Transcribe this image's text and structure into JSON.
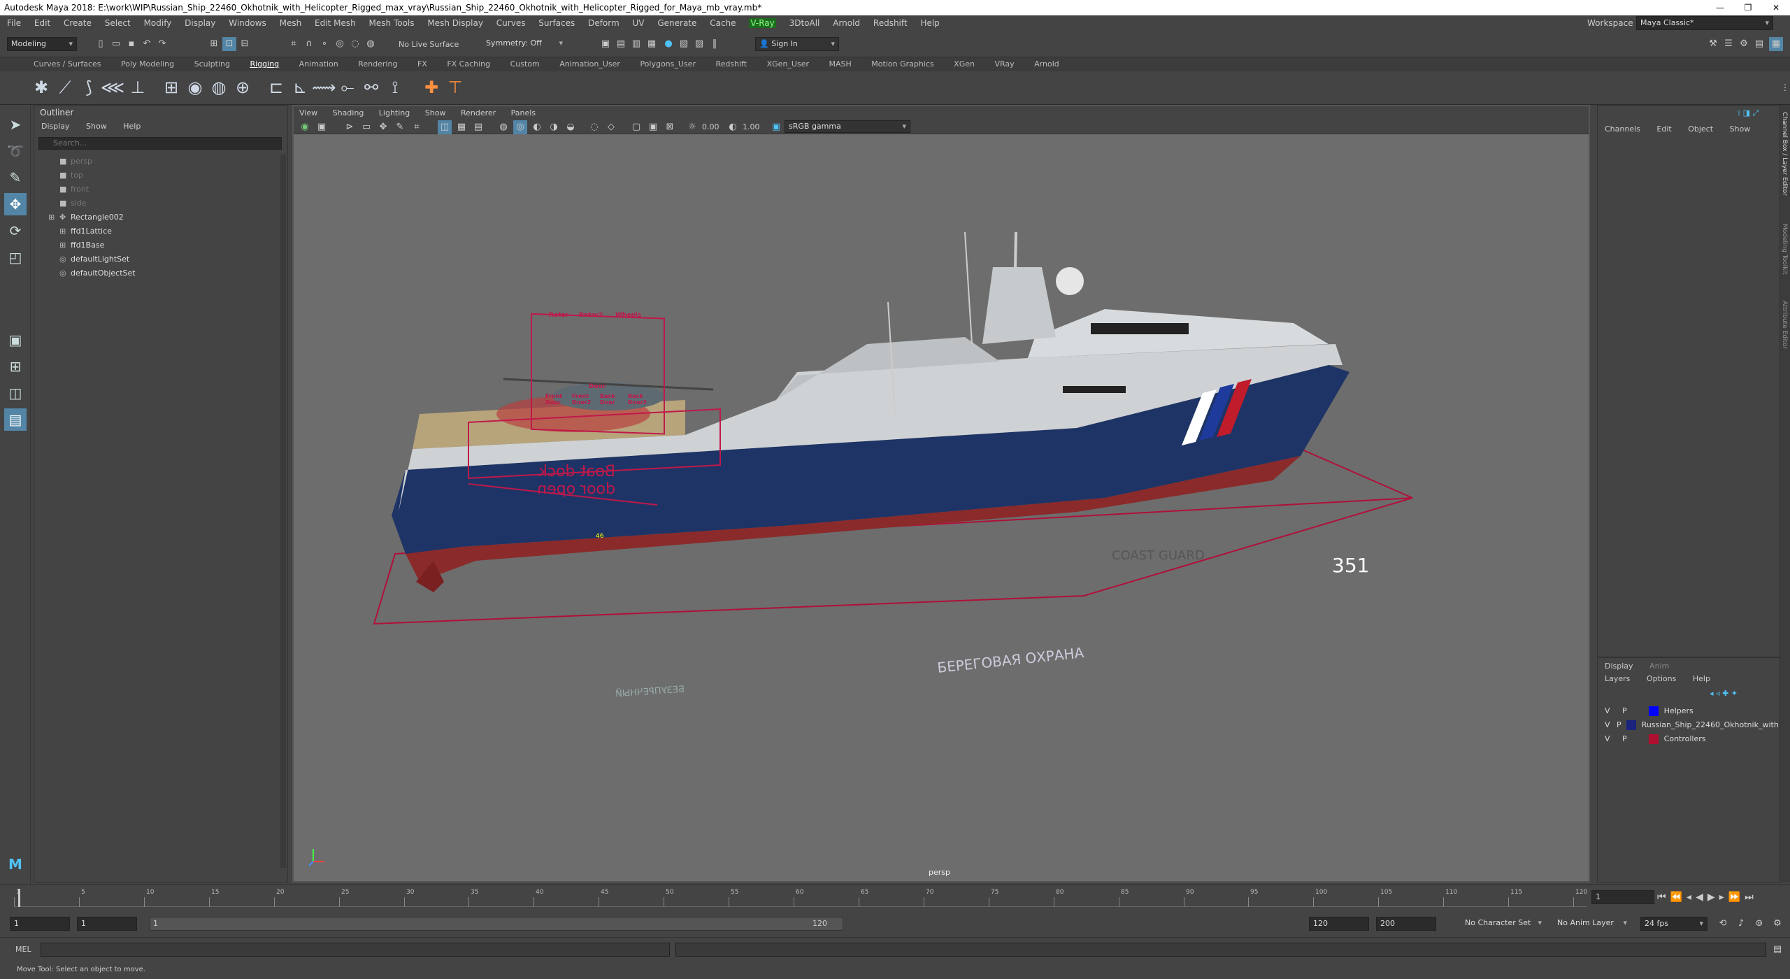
{
  "window": {
    "title": "Autodesk Maya 2018: E:\\work\\WIP\\Russian_Ship_22460_Okhotnik_with_Helicopter_Rigged_max_vray\\Russian_Ship_22460_Okhotnik_with_Helicopter_Rigged_for_Maya_mb_vray.mb*"
  },
  "menubar": [
    "File",
    "Edit",
    "Create",
    "Select",
    "Modify",
    "Display",
    "Windows",
    "Mesh",
    "Edit Mesh",
    "Mesh Tools",
    "Mesh Display",
    "Curves",
    "Surfaces",
    "Deform",
    "UV",
    "Generate",
    "Cache",
    "V-Ray",
    "3DtoAll",
    "Arnold",
    "Redshift",
    "Help"
  ],
  "workspace": {
    "label": "Workspace :",
    "value": "Maya Classic*"
  },
  "statusline": {
    "mode": "Modeling",
    "live_surface": "No Live Surface",
    "symmetry": "Symmetry: Off",
    "sign_in": "Sign In"
  },
  "shelf_tabs": [
    "Curves / Surfaces",
    "Poly Modeling",
    "Sculpting",
    "Rigging",
    "Animation",
    "Rendering",
    "FX",
    "FX Caching",
    "Custom",
    "Animation_User",
    "Polygons_User",
    "Redshift",
    "XGen_User",
    "MASH",
    "Motion Graphics",
    "XGen",
    "VRay",
    "Arnold"
  ],
  "shelf_active": "Rigging",
  "outliner": {
    "title": "Outliner",
    "menu": [
      "Display",
      "Show",
      "Help"
    ],
    "search_placeholder": "Search...",
    "items": [
      {
        "label": "persp",
        "icon": "camera-icon",
        "dim": true
      },
      {
        "label": "top",
        "icon": "camera-icon",
        "dim": true
      },
      {
        "label": "front",
        "icon": "camera-icon",
        "dim": true
      },
      {
        "label": "side",
        "icon": "camera-icon",
        "dim": true
      },
      {
        "label": "Rectangle002",
        "icon": "transform-icon",
        "dim": false
      },
      {
        "label": "ffd1Lattice",
        "icon": "lattice-icon",
        "dim": false
      },
      {
        "label": "ffd1Base",
        "icon": "lattice-icon",
        "dim": false
      },
      {
        "label": "defaultLightSet",
        "icon": "set-icon",
        "dim": false
      },
      {
        "label": "defaultObjectSet",
        "icon": "set-icon",
        "dim": false
      }
    ]
  },
  "viewport": {
    "menu": [
      "View",
      "Shading",
      "Lighting",
      "Show",
      "Renderer",
      "Panels"
    ],
    "exposure": "0.00",
    "gamma": "1.00",
    "color_space": "sRGB gamma",
    "camera": "persp",
    "scene_text": {
      "controls_top": [
        "Rotor",
        "Rotor2",
        "Wheels"
      ],
      "door_header": "Door",
      "controls_bottom": [
        "Front Door",
        "Front Door2",
        "Back Door",
        "Back Door2"
      ],
      "dock_label": "Boat dock door open",
      "hull_number": "351",
      "coast_guard": "COAST GUARD",
      "russian_text": "БЕРЕГОВАЯ ОХРАНА",
      "ship_name": "БЕЗУПРЕЧНЫЙ",
      "heli_number": "46"
    }
  },
  "channelbox": {
    "menu": [
      "Channels",
      "Edit",
      "Object",
      "Show"
    ]
  },
  "layer_editor": {
    "tabs": [
      "Display",
      "Anim"
    ],
    "menu": [
      "Layers",
      "Options",
      "Help"
    ],
    "layers": [
      {
        "v": "V",
        "p": "P",
        "name": "Helpers",
        "color": "#0000ff"
      },
      {
        "v": "V",
        "p": "P",
        "name": "Russian_Ship_22460_Okhotnik_with",
        "color": "#1a237e"
      },
      {
        "v": "V",
        "p": "P",
        "name": "Controllers",
        "color": "#b01030"
      }
    ]
  },
  "right_strip": [
    "Channel Box / Layer Editor",
    "Modeling Toolkit",
    "Attribute Editor"
  ],
  "timeline": {
    "ticks": [
      "1",
      "5",
      "10",
      "15",
      "20",
      "25",
      "30",
      "35",
      "40",
      "45",
      "50",
      "55",
      "60",
      "65",
      "70",
      "75",
      "80",
      "85",
      "90",
      "95",
      "100",
      "105",
      "110",
      "115",
      "120"
    ],
    "current_frame": "1"
  },
  "range": {
    "start": "1",
    "range_start": "1",
    "range_slider_start": "1",
    "range_slider_end": "120",
    "range_end": "120",
    "end": "200",
    "character_set": "No Character Set",
    "anim_layer": "No Anim Layer",
    "fps": "24 fps"
  },
  "command": {
    "label": "MEL"
  },
  "help_line": "Move Tool: Select an object to move."
}
